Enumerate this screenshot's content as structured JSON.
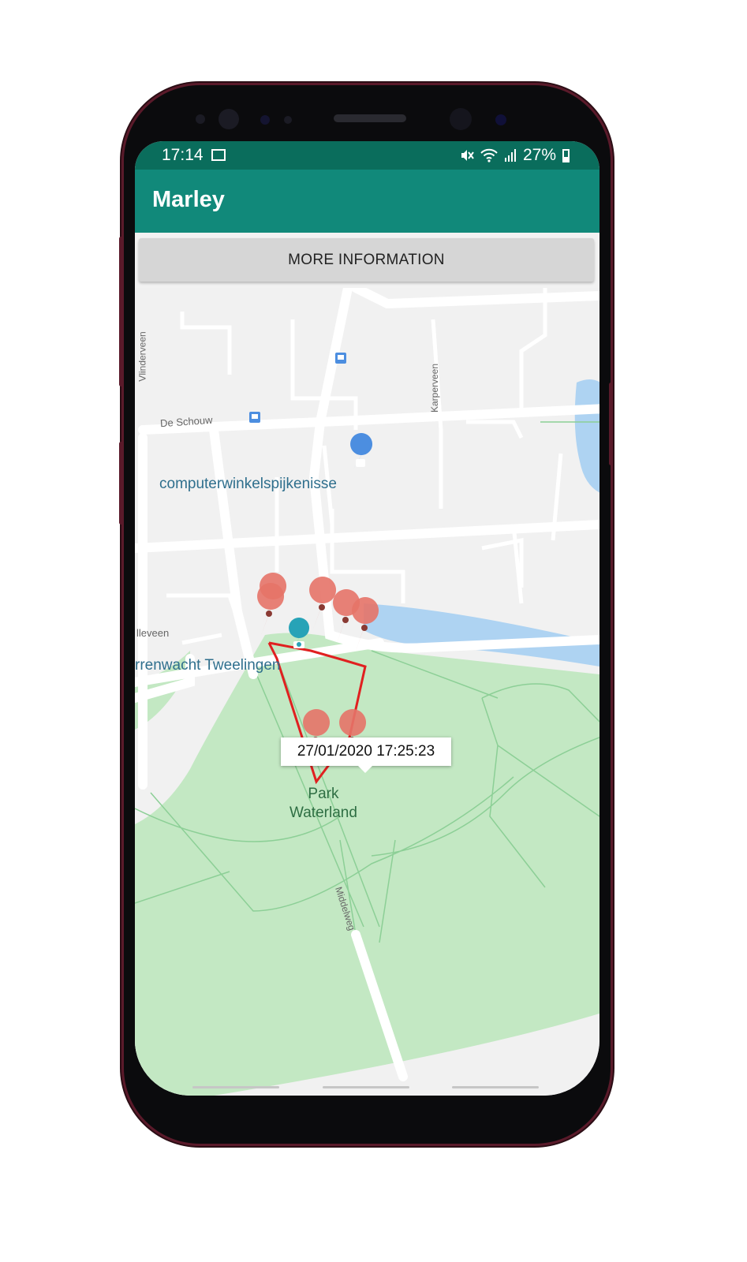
{
  "status_bar": {
    "time": "17:14",
    "battery": "27%"
  },
  "app_bar": {
    "title": "Marley"
  },
  "more_info_button": {
    "label": "MORE INFORMATION"
  },
  "map": {
    "info_window": "27/01/2020 17:25:23",
    "labels": {
      "place_shop": "computerwinkelspijkenisse",
      "place_observatory": "rrenwacht Tweelingen",
      "park": "Park",
      "park2": "Waterland",
      "street_de_schouw": "De Schouw",
      "street_vlinderveen": "Vlinderveen",
      "street_karperveen": "Karperveen",
      "street_lleveen": "lleveen",
      "street_middelweg": "Middelweg"
    },
    "provider": "Google",
    "route_color": "#e02020",
    "marker_color": "#e57368"
  },
  "icons": {
    "directions": "directions-icon",
    "maps_app": "google-maps-icon"
  }
}
